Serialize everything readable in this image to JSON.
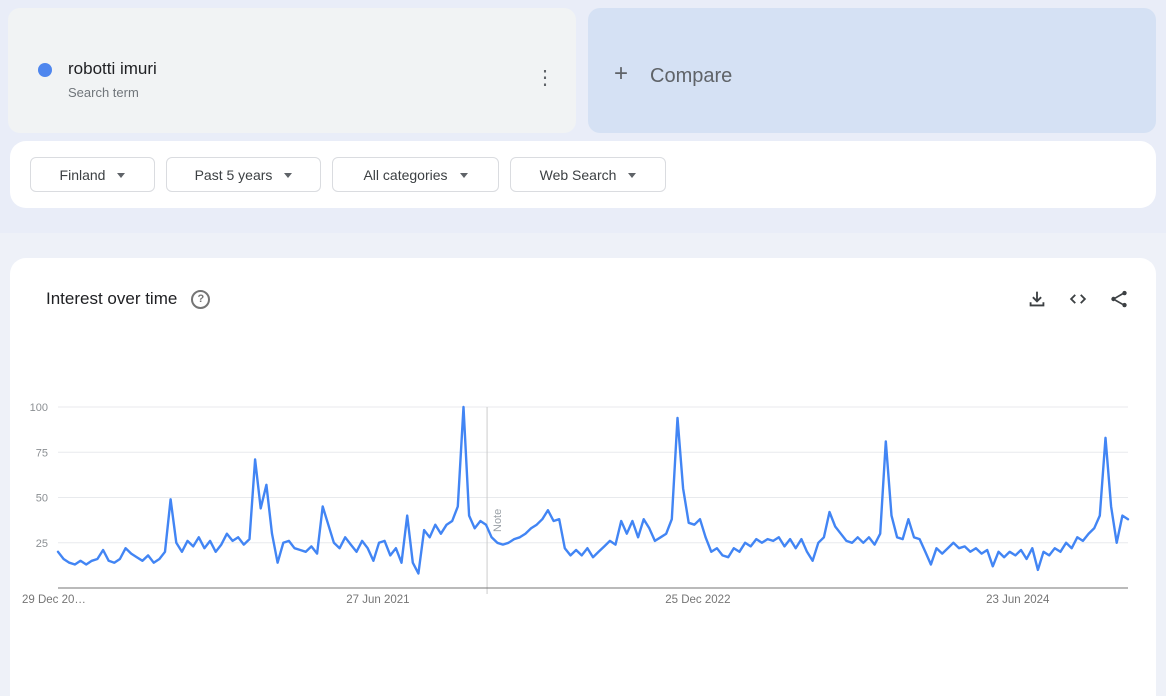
{
  "search_card": {
    "term": "robotti imuri",
    "type_label": "Search term",
    "dot_color": "#4e86ee",
    "menu_glyph": "⋮"
  },
  "compare_card": {
    "plus": "+",
    "label": "Compare"
  },
  "filters": [
    {
      "label": "Finland"
    },
    {
      "label": "Past 5 years"
    },
    {
      "label": "All categories"
    },
    {
      "label": "Web Search"
    }
  ],
  "chart_section": {
    "title": "Interest over time",
    "help_glyph": "?",
    "actions": [
      {
        "name": "download"
      },
      {
        "name": "embed"
      },
      {
        "name": "share"
      }
    ]
  },
  "chart_data": {
    "type": "line",
    "title": "Interest over time",
    "series_name": "robotti imuri",
    "region": "Finland",
    "time_range": "Past 5 years",
    "line_color": "#4285f4",
    "grid_color": "#e8eaed",
    "baseline_color": "#757575",
    "axis_text_color": "#757575",
    "ylim": [
      0,
      100
    ],
    "y_ticks": [
      100,
      75,
      50,
      25
    ],
    "x_axis": {
      "start_label": "29 Dec 20…",
      "ticks": [
        {
          "label": "27 Jun 2021",
          "fraction": 0.299
        },
        {
          "label": "25 Dec 2022",
          "fraction": 0.598
        },
        {
          "label": "23 Jun 2024",
          "fraction": 0.897
        }
      ]
    },
    "note_marker": {
      "label": "Note",
      "fraction": 0.401,
      "line_color": "#cccccc",
      "text_color": "#9aa0a6"
    },
    "values": [
      20,
      16,
      14,
      13,
      15,
      13,
      15,
      16,
      21,
      15,
      14,
      16,
      22,
      19,
      17,
      15,
      18,
      14,
      16,
      20,
      49,
      25,
      20,
      26,
      23,
      28,
      22,
      26,
      20,
      24,
      30,
      26,
      28,
      24,
      27,
      71,
      44,
      57,
      30,
      14,
      25,
      26,
      22,
      21,
      20,
      23,
      19,
      45,
      35,
      25,
      22,
      28,
      24,
      20,
      26,
      22,
      15,
      25,
      26,
      18,
      22,
      14,
      40,
      14,
      8,
      32,
      28,
      35,
      30,
      35,
      37,
      45,
      100,
      40,
      33,
      37,
      35,
      28,
      25,
      24,
      25,
      27,
      28,
      30,
      33,
      35,
      38,
      43,
      37,
      38,
      22,
      18,
      21,
      18,
      22,
      17,
      20,
      23,
      26,
      24,
      37,
      30,
      37,
      28,
      38,
      33,
      26,
      28,
      30,
      38,
      94,
      55,
      36,
      35,
      38,
      28,
      20,
      22,
      18,
      17,
      22,
      20,
      25,
      23,
      27,
      25,
      27,
      26,
      28,
      23,
      27,
      22,
      27,
      20,
      15,
      25,
      28,
      42,
      34,
      30,
      26,
      25,
      28,
      25,
      28,
      24,
      30,
      81,
      40,
      28,
      27,
      38,
      28,
      27,
      20,
      13,
      22,
      19,
      22,
      25,
      22,
      23,
      20,
      22,
      19,
      21,
      12,
      20,
      17,
      20,
      18,
      21,
      16,
      22,
      10,
      20,
      18,
      22,
      20,
      25,
      22,
      28,
      26,
      30,
      33,
      40,
      83,
      45,
      25,
      40,
      38
    ]
  }
}
